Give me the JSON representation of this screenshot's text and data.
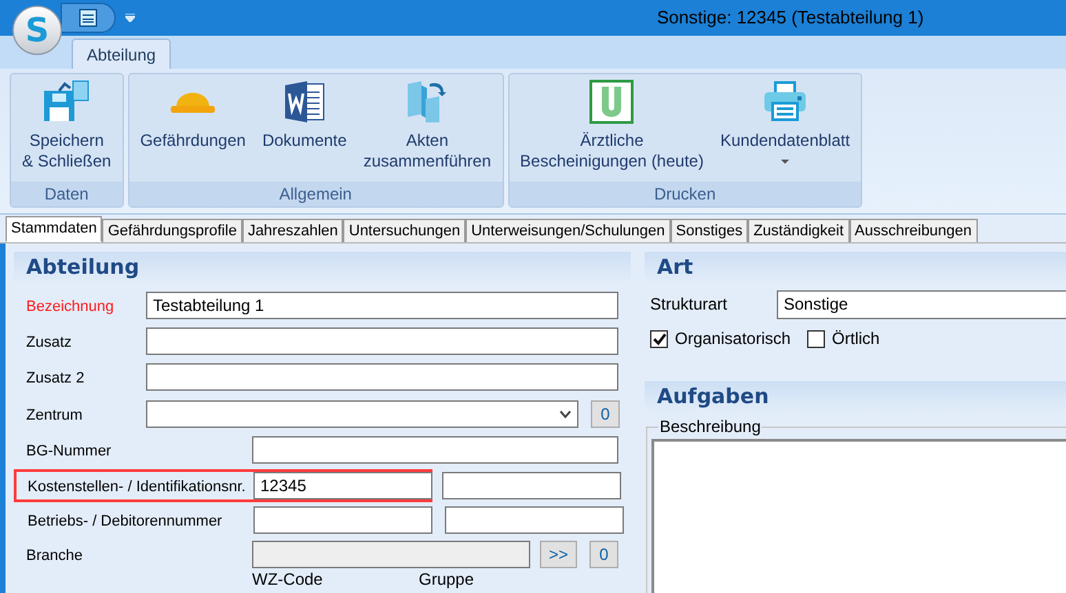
{
  "app": {
    "logo_letter": "S"
  },
  "window": {
    "title": "Sonstige: 12345 (Testabteilung 1)"
  },
  "ribbon_tabs": [
    {
      "label": "Abteilung",
      "selected": true
    }
  ],
  "ribbon_groups": [
    {
      "label": "Daten",
      "buttons": [
        {
          "kind": "save",
          "lines": [
            "Speichern",
            "& Schließen"
          ],
          "dropdown": false
        }
      ]
    },
    {
      "label": "Allgemein",
      "buttons": [
        {
          "kind": "helmet",
          "lines": [
            "Gefährdungen"
          ],
          "dropdown": false
        },
        {
          "kind": "word",
          "lines": [
            "Dokumente"
          ],
          "dropdown": false
        },
        {
          "kind": "merge",
          "lines": [
            "Akten",
            "zusammenführen"
          ],
          "dropdown": false
        }
      ]
    },
    {
      "label": "Drucken",
      "buttons": [
        {
          "kind": "certificate",
          "lines": [
            "Ärztliche",
            "Bescheinigungen (heute)"
          ],
          "dropdown": false
        },
        {
          "kind": "printer",
          "lines": [
            "Kundendatenblatt"
          ],
          "dropdown": true
        }
      ]
    }
  ],
  "tabs": [
    {
      "label": "Stammdaten",
      "selected": true
    },
    {
      "label": "Gefährdungsprofile",
      "selected": false
    },
    {
      "label": "Jahreszahlen",
      "selected": false
    },
    {
      "label": "Untersuchungen",
      "selected": false
    },
    {
      "label": "Unterweisungen/Schulungen",
      "selected": false
    },
    {
      "label": "Sonstiges",
      "selected": false
    },
    {
      "label": "Zuständigkeit",
      "selected": false
    },
    {
      "label": "Ausschreibungen",
      "selected": false
    }
  ],
  "abteilung": {
    "title": "Abteilung",
    "rows": [
      {
        "kind": "wide",
        "label": "Bezeichnung",
        "required": true,
        "value": "Testabteilung 1"
      },
      {
        "kind": "wide",
        "label": "Zusatz",
        "required": false
      },
      {
        "kind": "wide",
        "label": "Zusatz 2",
        "required": false
      },
      {
        "kind": "combo",
        "label": "Zentrum",
        "required": false,
        "count": "0"
      },
      {
        "kind": "single",
        "label": "BG-Nummer",
        "required": false
      },
      {
        "kind": "pair",
        "label": "Kostenstellen- / Identifikationsnr.",
        "required": false,
        "highlighted": true,
        "value": "12345"
      },
      {
        "kind": "pair",
        "label": "Betriebs- / Debitorennummer",
        "required": false,
        "highlighted": false
      },
      {
        "kind": "picker",
        "label": "Branche",
        "required": false,
        "disabled": true,
        "button": ">>",
        "count": "0"
      }
    ],
    "sublabels": [
      "WZ-Code",
      "Gruppe"
    ]
  },
  "art": {
    "title": "Art",
    "strukturart": {
      "label": "Strukturart",
      "value": "Sonstige"
    },
    "checkboxes": [
      {
        "label": "Organisatorisch",
        "checked": true
      },
      {
        "label": "Örtlich",
        "checked": false
      }
    ]
  },
  "aufgaben": {
    "title": "Aufgaben",
    "group_label": "Beschreibung"
  }
}
